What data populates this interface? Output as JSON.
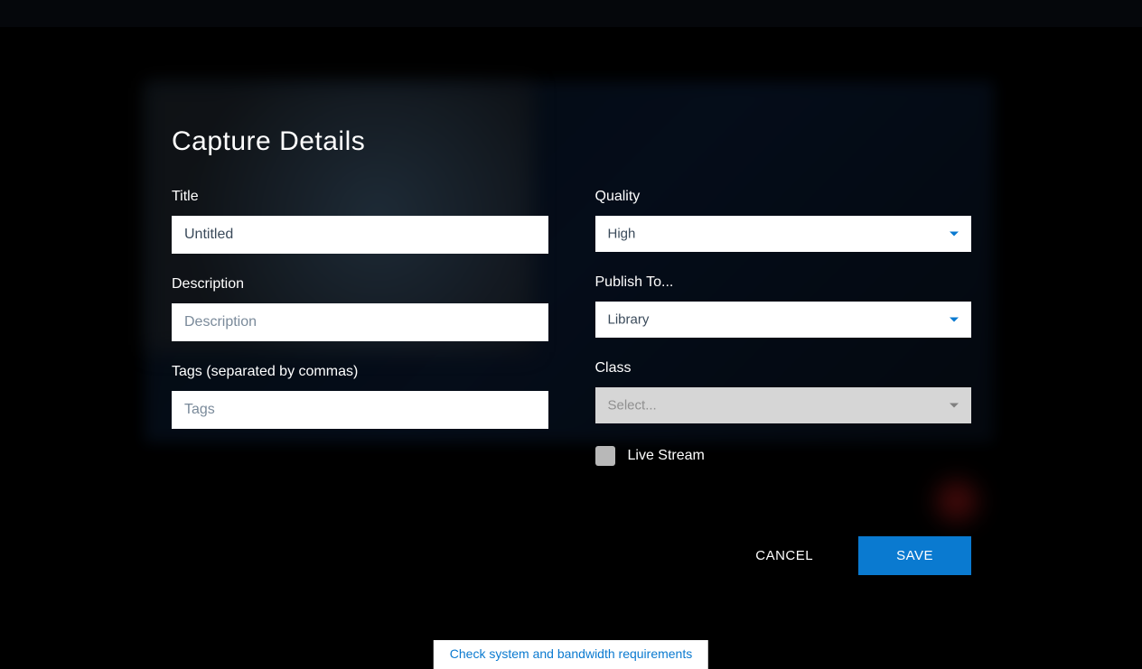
{
  "modal": {
    "title": "Capture Details",
    "left": {
      "title_label": "Title",
      "title_value": "Untitled",
      "description_label": "Description",
      "description_placeholder": "Description",
      "tags_label": "Tags (separated by commas)",
      "tags_placeholder": "Tags"
    },
    "right": {
      "quality_label": "Quality",
      "quality_value": "High",
      "publish_label": "Publish To...",
      "publish_value": "Library",
      "class_label": "Class",
      "class_value": "Select...",
      "live_stream_label": "Live Stream"
    },
    "actions": {
      "cancel": "CANCEL",
      "save": "SAVE"
    }
  },
  "footer": {
    "link_text": "Check system and bandwidth requirements"
  }
}
